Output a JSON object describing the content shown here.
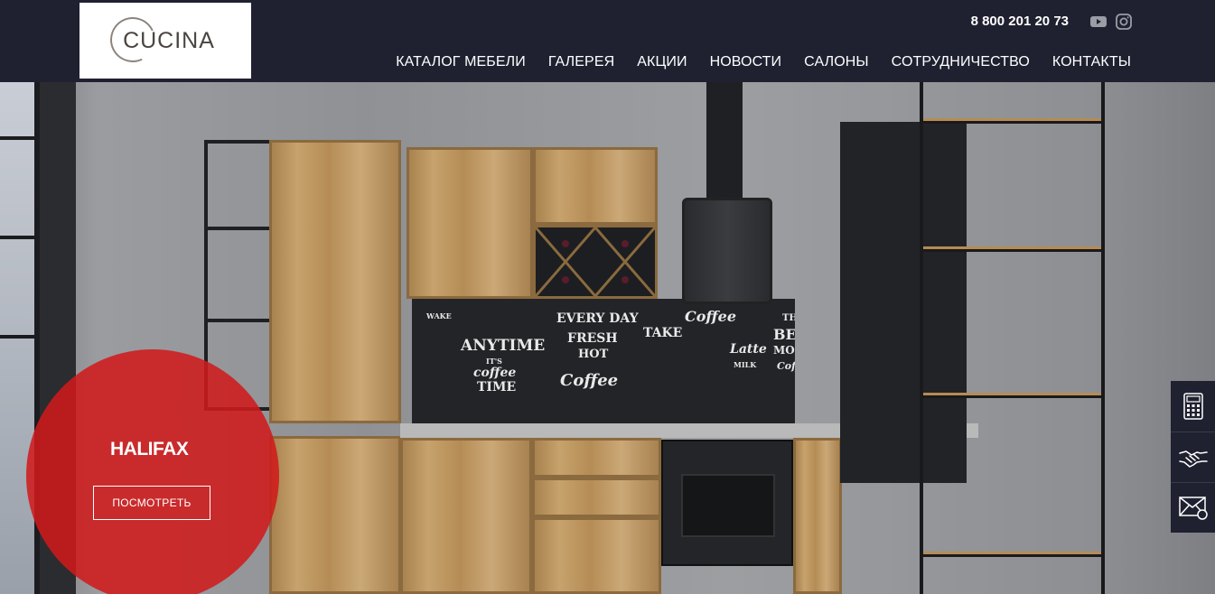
{
  "header": {
    "logo_text": "CUCINA",
    "phone": "8 800 201 20 73",
    "social_icons": [
      "youtube-icon",
      "instagram-icon"
    ],
    "nav": [
      {
        "label": "КАТАЛОГ МЕБЕЛИ"
      },
      {
        "label": "ГАЛЕРЕЯ"
      },
      {
        "label": "АКЦИИ"
      },
      {
        "label": "НОВОСТИ"
      },
      {
        "label": "САЛОНЫ"
      },
      {
        "label": "СОТРУДНИЧЕСТВО"
      },
      {
        "label": "КОНТАКТЫ"
      }
    ]
  },
  "hero": {
    "promo": {
      "title": "HALIFAX",
      "button_label": "ПОСМОТРЕТЬ"
    },
    "backsplash": {
      "words": [
        "WAKE",
        "ANYTIME",
        "IT'S",
        "coffee",
        "TIME",
        "EVERY DAY",
        "FRESH",
        "HOT",
        "Coffee",
        "TAKE",
        "Coffee",
        "Latte",
        "MILK",
        "THE",
        "BEST",
        "MORNING",
        "Coffee"
      ]
    }
  },
  "side_panel": {
    "icons": [
      "calculator-icon",
      "handshake-icon",
      "mail-icon"
    ]
  },
  "colors": {
    "header_bg": "#1f2130",
    "promo_red": "#d01a1c",
    "wood": "#c7a26c",
    "text_light": "#ffffff"
  }
}
